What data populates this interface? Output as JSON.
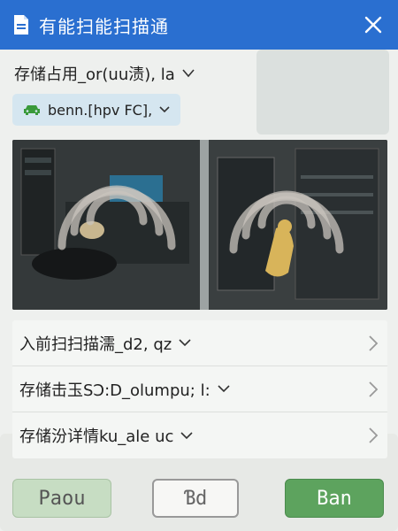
{
  "title_bar": {
    "title": "有能扫能扫描通",
    "doc_icon": "document-icon",
    "close_icon": "close-icon",
    "accent": "#2a6fd0"
  },
  "storage_selector": {
    "label": "存储占用_or(uu渍), la",
    "icon": "chevron-down-icon"
  },
  "device_chip": {
    "label": "benn.[hpv FC],",
    "icon": "car-icon",
    "icon_color": "#3a9a3a"
  },
  "preview": {
    "panels": 2,
    "overlay_icon": "wireless-signal-icon"
  },
  "list": {
    "items": [
      {
        "label": "入前扫扫描濡_d2, qz"
      },
      {
        "label": "存储击玉SƆ:D_olumpu; l:"
      },
      {
        "label": "存储汾详情ku_ale uc"
      }
    ]
  },
  "buttons": {
    "left": "Paou",
    "middle": "Ɓd",
    "right": "Ban",
    "primary_color": "#5da35e"
  }
}
